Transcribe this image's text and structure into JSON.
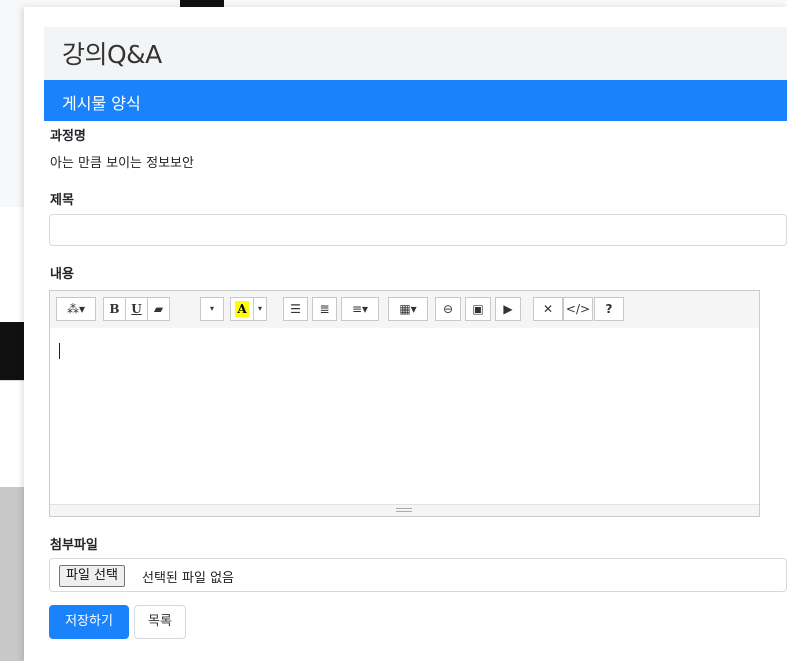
{
  "page": {
    "title": "강의Q&A"
  },
  "form": {
    "header": "게시물 양식",
    "course_label": "과정명",
    "course_value": "아는 만큼 보이는 정보보안",
    "title_label": "제목",
    "title_value": "",
    "content_label": "내용",
    "attachment_label": "첨부파일",
    "file_button": "파일 선택",
    "file_status": "선택된 파일 없음",
    "save_button": "저장하기",
    "list_button": "목록"
  },
  "editor": {
    "toolbar": [
      {
        "name": "style-button",
        "icon": "magic-wand-icon",
        "glyph": "⁂▾"
      },
      {
        "name": "bold-button",
        "icon": "bold-icon",
        "glyph": "B"
      },
      {
        "name": "underline-button",
        "icon": "underline-icon",
        "glyph": "U"
      },
      {
        "name": "clear-format-button",
        "icon": "eraser-icon",
        "glyph": "▰"
      },
      {
        "name": "font-size-button",
        "icon": "caret-down-icon",
        "glyph": "▾"
      },
      {
        "name": "color-button",
        "icon": "text-color-icon",
        "glyph": "A"
      },
      {
        "name": "color-dropdown-button",
        "icon": "caret-down-icon",
        "glyph": "▾"
      },
      {
        "name": "unordered-list-button",
        "icon": "unordered-list-icon",
        "glyph": "☰"
      },
      {
        "name": "ordered-list-button",
        "icon": "ordered-list-icon",
        "glyph": "≣"
      },
      {
        "name": "paragraph-button",
        "icon": "align-left-icon",
        "glyph": "≡▾"
      },
      {
        "name": "table-button",
        "icon": "table-icon",
        "glyph": "▦▾"
      },
      {
        "name": "link-button",
        "icon": "link-icon",
        "glyph": "⊖"
      },
      {
        "name": "picture-button",
        "icon": "picture-icon",
        "glyph": "▣"
      },
      {
        "name": "video-button",
        "icon": "video-icon",
        "glyph": "▶"
      },
      {
        "name": "fullscreen-button",
        "icon": "fullscreen-icon",
        "glyph": "✕"
      },
      {
        "name": "codeview-button",
        "icon": "code-icon",
        "glyph": "</>"
      },
      {
        "name": "help-button",
        "icon": "help-icon",
        "glyph": "?"
      }
    ]
  },
  "colors": {
    "primary": "#1a82fb",
    "header_bg": "#f3f4f6",
    "highlight": "#ffff00"
  }
}
